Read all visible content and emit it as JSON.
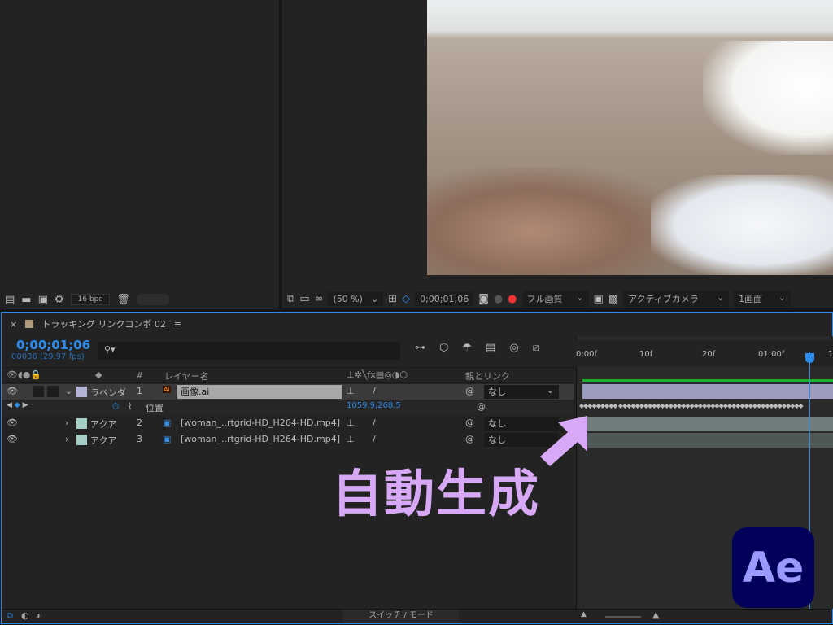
{
  "project": {
    "bpc": "16 bpc"
  },
  "viewer": {
    "zoom": "(50 %)",
    "timecode": "0;00;01;06",
    "quality": "フル画質",
    "camera": "アクティブカメラ",
    "views": "1画面"
  },
  "timeline": {
    "tab_title": "トラッキング リンクコンポ 02",
    "timecode": "0;00;01;06",
    "frame_info": "00036 (29.97 fps)",
    "search_placeholder": "",
    "columns": {
      "num": "#",
      "layer_name": "レイヤー名",
      "parent": "親とリンク"
    },
    "layers": [
      {
        "label": "ラベンダ",
        "label_color": "#b4b4d8",
        "num": "1",
        "name": "画像.ai",
        "parent": "なし"
      },
      {
        "label": "アクア",
        "label_color": "#a6cfc8",
        "num": "2",
        "name": "[woman_..rtgrid-HD_H264-HD.mp4]",
        "parent": "なし"
      },
      {
        "label": "アクア",
        "label_color": "#a6cfc8",
        "num": "3",
        "name": "[woman_..rtgrid-HD_H264-HD.mp4]",
        "parent": "なし"
      }
    ],
    "property": {
      "name": "位置",
      "value": "1059.9,268.5"
    },
    "ruler": [
      "0:00f",
      "10f",
      "20f",
      "01:00f",
      "1"
    ],
    "switch_mode": "スイッチ / モード",
    "comp_color": "#b09c7c"
  },
  "overlay": {
    "text": "自動生成",
    "color": "#d6a8f6"
  },
  "logo": {
    "text": "Ae"
  }
}
